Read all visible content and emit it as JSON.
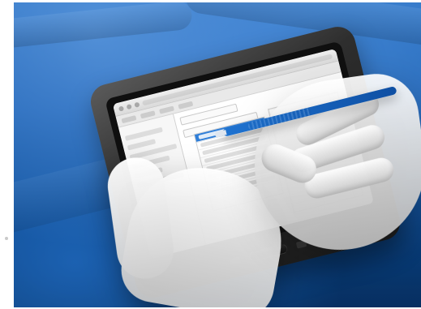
{
  "image": {
    "palette": {
      "background_blue": "#1f5ca6",
      "stylus_blue": "#1f73d1",
      "selected_row_blue": "#2f7ed8",
      "tablet_dark": "#1a1a1a",
      "screen_light": "#f3f3f3"
    },
    "icons": {
      "stylus": "stylus-icon",
      "tablet": "tablet-icon",
      "hand": "hand-icon"
    }
  }
}
